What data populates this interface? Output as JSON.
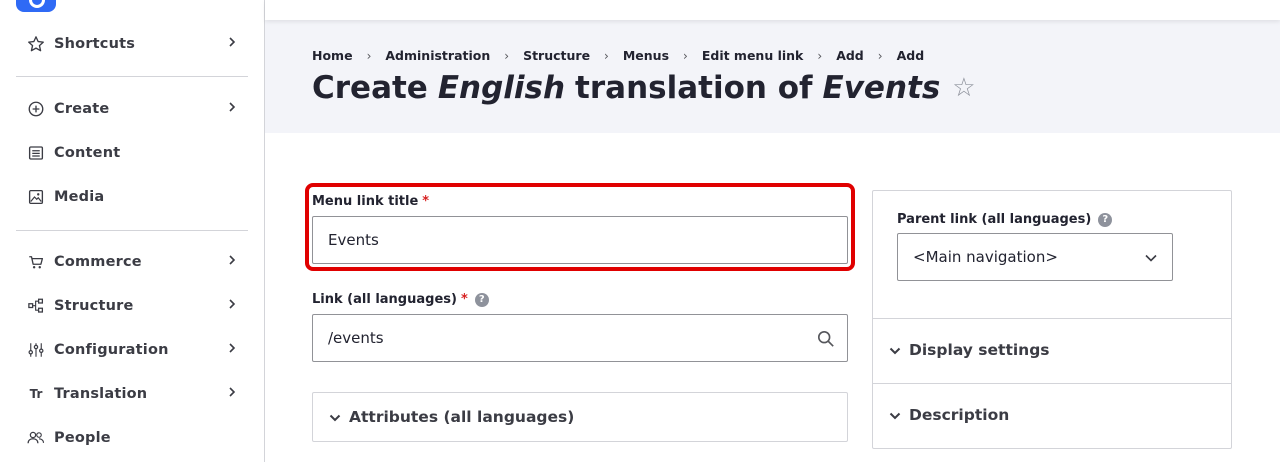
{
  "sidebar": {
    "items": [
      {
        "label": "Shortcuts",
        "icon": "star-icon"
      },
      {
        "label": "Create",
        "icon": "plus-circle-icon"
      },
      {
        "label": "Content",
        "icon": "document-icon"
      },
      {
        "label": "Media",
        "icon": "image-icon"
      },
      {
        "label": "Commerce",
        "icon": "cart-icon"
      },
      {
        "label": "Structure",
        "icon": "structure-icon"
      },
      {
        "label": "Configuration",
        "icon": "sliders-icon"
      },
      {
        "label": "Translation",
        "icon": "translation-icon",
        "glyph": "Tr"
      },
      {
        "label": "People",
        "icon": "people-icon"
      }
    ]
  },
  "breadcrumb": [
    "Home",
    "Administration",
    "Structure",
    "Menus",
    "Edit menu link",
    "Add",
    "Add"
  ],
  "page_title": {
    "prefix": "Create",
    "language": "English",
    "middle": "translation of",
    "entity": "Events"
  },
  "form": {
    "title_label": "Menu link title",
    "title_value": "Events",
    "link_label": "Link (all languages)",
    "link_value": "/events",
    "attributes_label": "Attributes (all languages)",
    "help_glyph": "?",
    "required_glyph": "*"
  },
  "side": {
    "parent_label": "Parent link (all languages)",
    "parent_value": "<Main navigation>",
    "display_settings": "Display settings",
    "description": "Description"
  },
  "colors": {
    "accent": "#2f6af5",
    "highlight": "#e00000",
    "required": "#d72222"
  }
}
